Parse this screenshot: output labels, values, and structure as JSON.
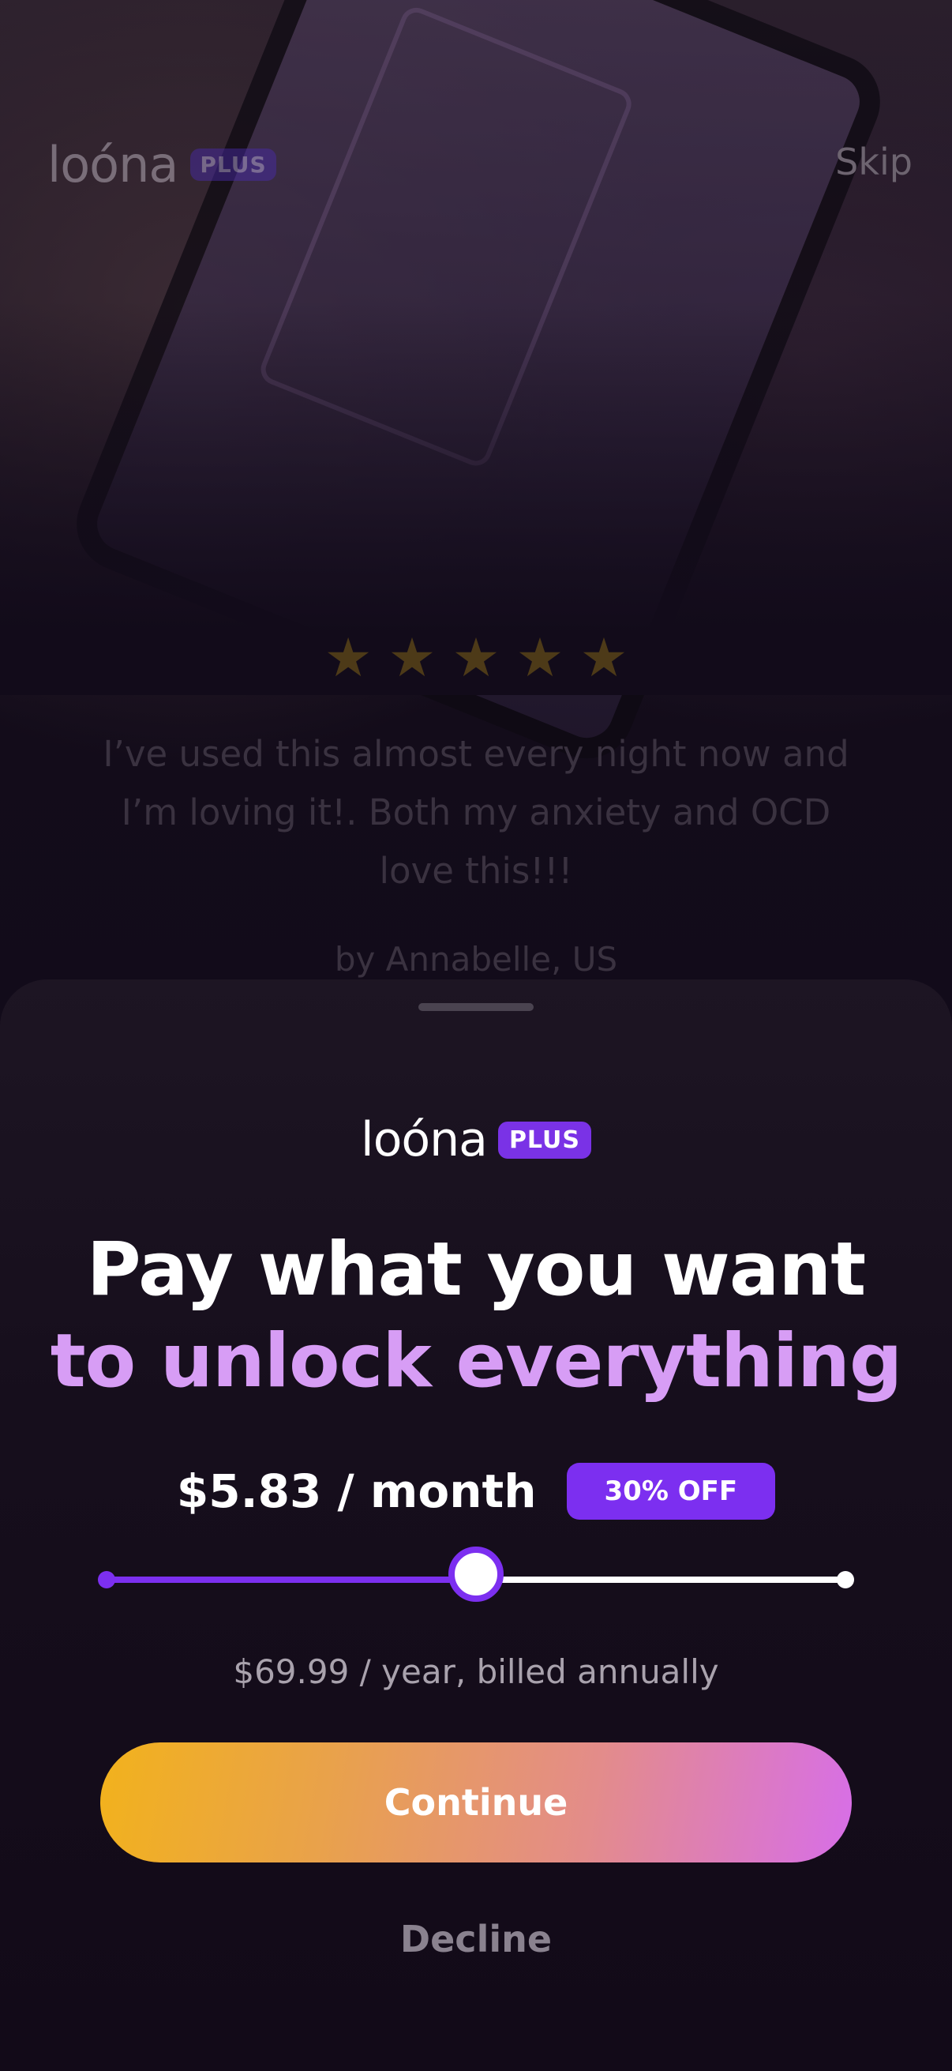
{
  "background": {
    "logo_text": "loóna",
    "plus_label": "PLUS",
    "skip_label": "Skip",
    "rating_stars": 5,
    "review_text": "I’ve used this almost every night now and I’m loving it!. Both my anxiety and OCD love this!!!",
    "reviewer": "by Annabelle, US"
  },
  "sheet": {
    "logo_text": "loóna",
    "plus_label": "PLUS",
    "headline_line1": "Pay what you want",
    "headline_line2": "to unlock everything",
    "price_text": "$5.83 / month",
    "discount_badge": "30% OFF",
    "slider_value_fraction": 0.5,
    "billing_text": "$69.99 / year, billed annually",
    "continue_label": "Continue",
    "decline_label": "Decline"
  },
  "colors": {
    "accent_purple": "#7c2ff0",
    "headline_purple": "#d79df5",
    "button_gradient_start": "#f2b21c",
    "button_gradient_end": "#d76ee8"
  }
}
